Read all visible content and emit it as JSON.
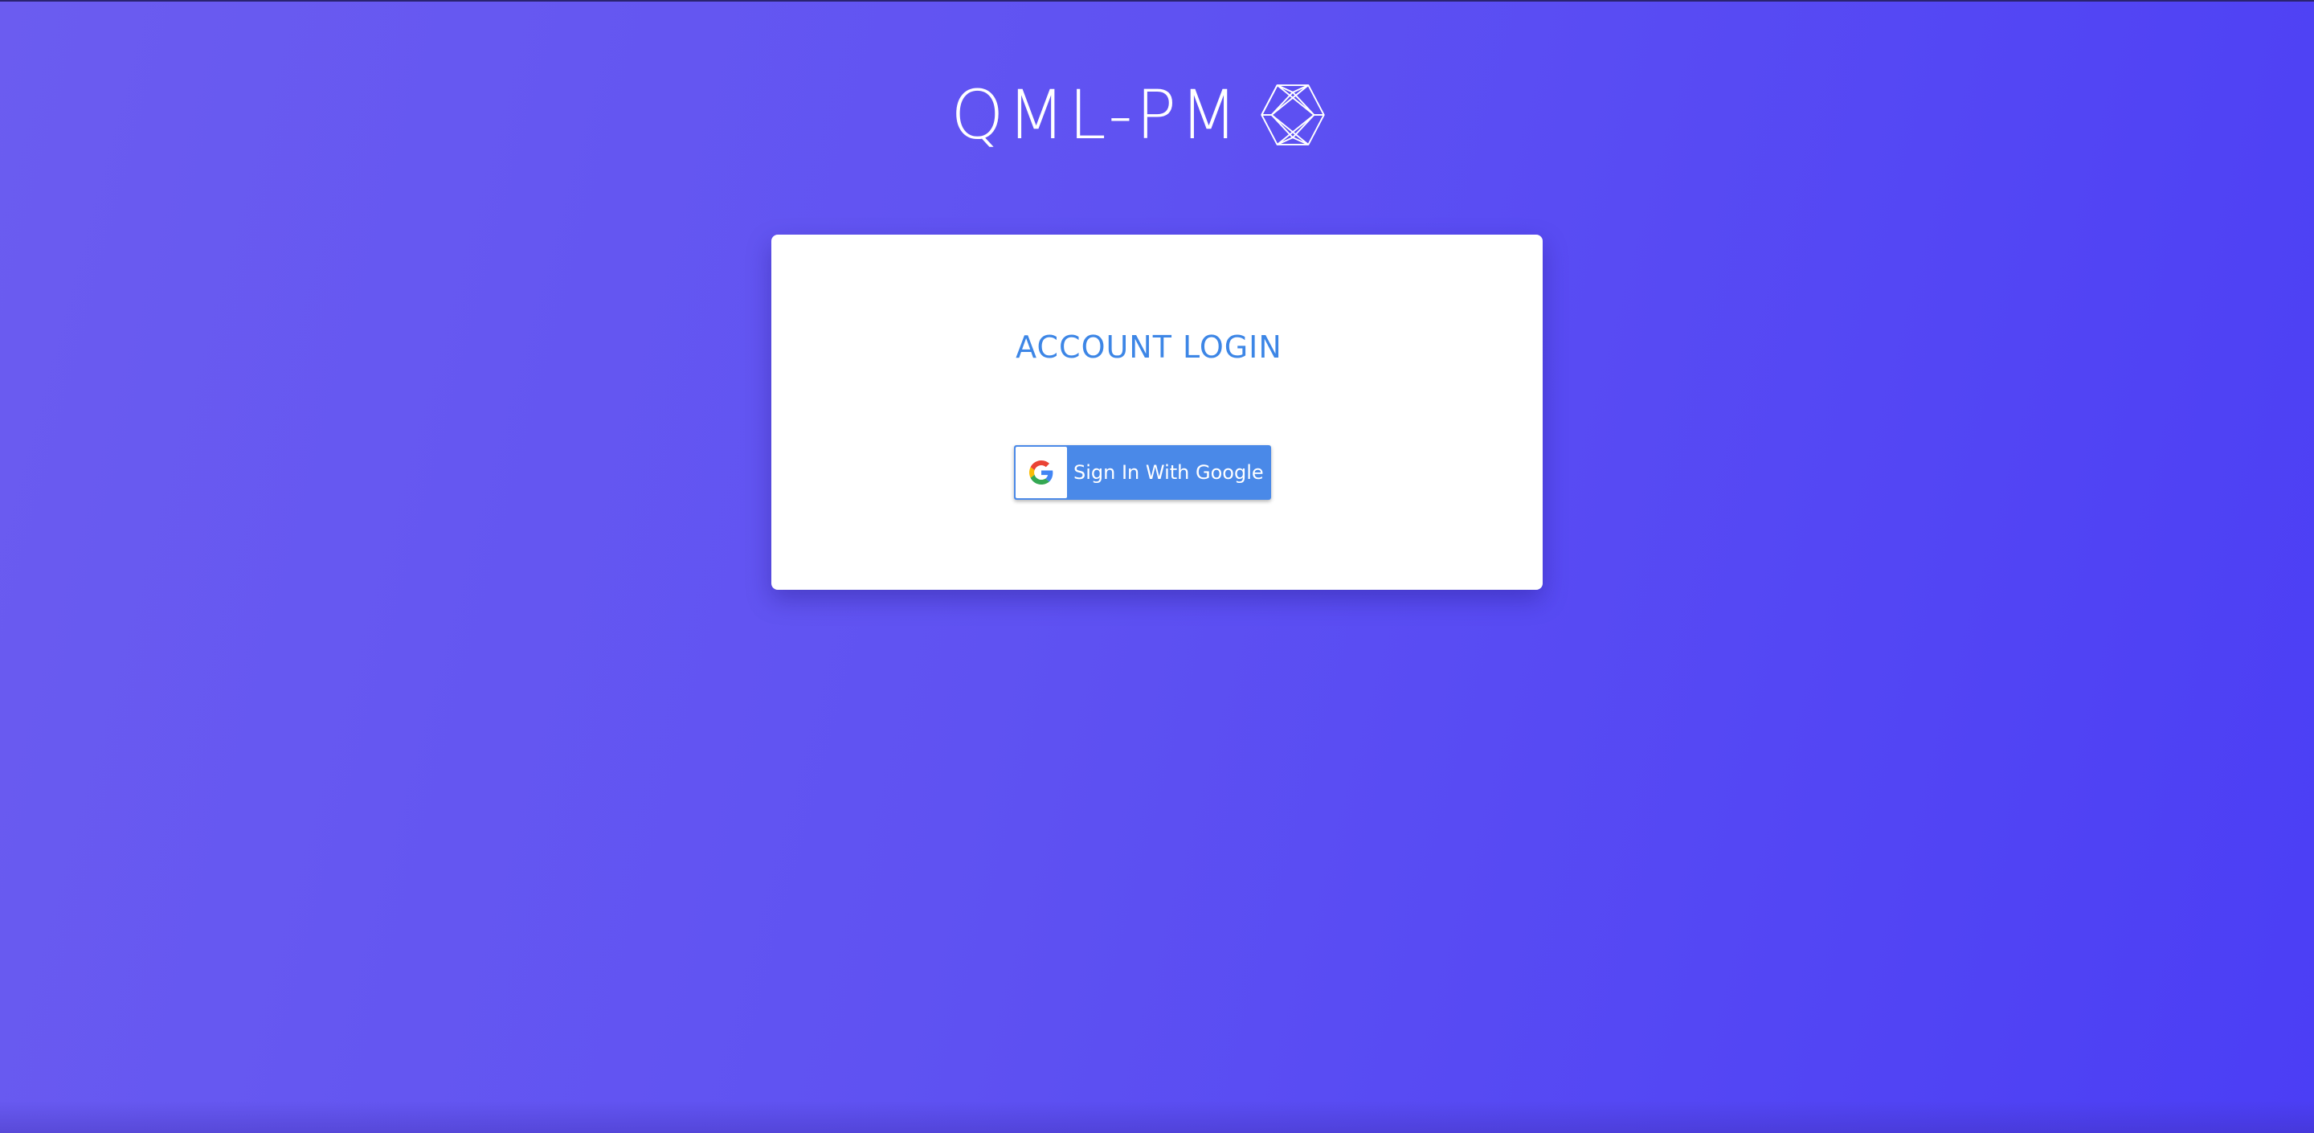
{
  "brand": {
    "title": "QML-PM",
    "logo_icon": "geometric-polyhedron-icon"
  },
  "login_card": {
    "title": "ACCOUNT LOGIN",
    "google_button": {
      "label": "Sign In With Google",
      "icon": "google-g-icon"
    }
  },
  "colors": {
    "background_start": "#6b5cf0",
    "background_end": "#4b3ef5",
    "title_blue": "#3d86e6",
    "google_button_blue": "#4a89e8",
    "card": "#ffffff"
  }
}
